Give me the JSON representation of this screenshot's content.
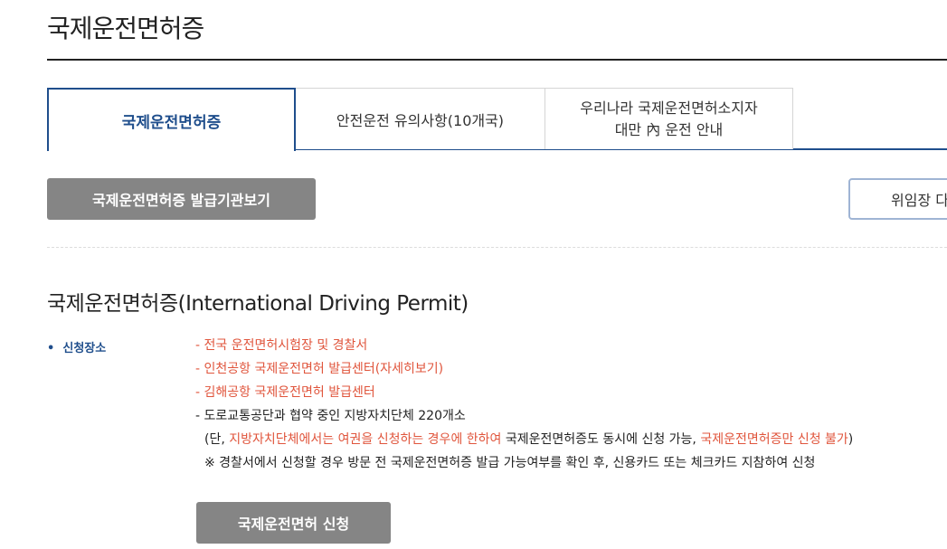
{
  "page": {
    "title": "국제운전면허증"
  },
  "tabs": [
    {
      "label": "국제운전면허증"
    },
    {
      "label": "안전운전 유의사항(10개국)"
    },
    {
      "line1": "우리나라 국제운전면허소지자",
      "line2": "대만 內 운전 안내"
    }
  ],
  "buttons": {
    "issuer_list": "국제운전면허증 발급기관보기",
    "power_of_attorney": "위임장 다",
    "apply": "국제운전면허 신청"
  },
  "section": {
    "title": "국제운전면허증(International Driving Permit)",
    "label": "신청장소",
    "items": [
      "- 전국 운전면허시험장 및 경찰서",
      "- 인천공항 국제운전면허 발급센터(자세히보기)",
      "- 김해공항 국제운전면허 발급센터",
      "- 도로교통공단과 협약 중인 지방자치단체 220개소"
    ],
    "note": {
      "open": "(단, ",
      "red1": "지방자치단체에서는 여권을 신청하는 경우에 한하여",
      "mid": " 국제운전면허증도 동시에 신청 가능, ",
      "red2": "국제운전면허증만 신청 불가",
      "close": ")"
    },
    "police_note": "※ 경찰서에서 신청할 경우 방문 전 국제운전면허증 발급 가능여부를 확인 후, 신용카드 또는 체크카드 지참하여 신청"
  },
  "colors": {
    "accent": "#1f4e8c",
    "warning": "#e0553c",
    "button_gray": "#858585"
  }
}
